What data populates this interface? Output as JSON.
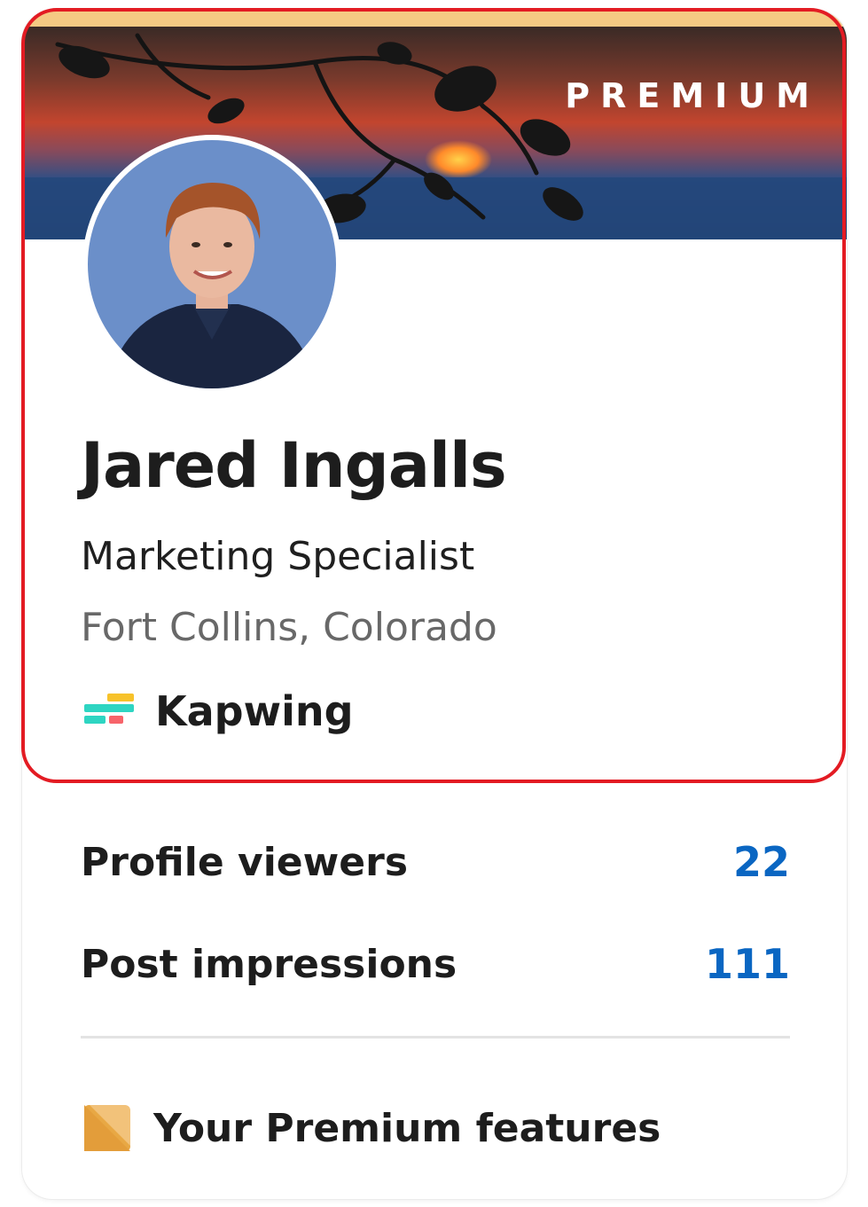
{
  "profile": {
    "badge": "PREMIUM",
    "name": "Jared Ingalls",
    "headline": "Marketing Specialist",
    "location": "Fort Collins, Colorado",
    "company": "Kapwing",
    "company_logo_icon": "kapwing-logo-icon"
  },
  "stats": [
    {
      "label": "Profile viewers",
      "value": "22"
    },
    {
      "label": "Post impressions",
      "value": "111"
    }
  ],
  "premium_features": {
    "label": "Your Premium features",
    "icon": "premium-square-icon"
  },
  "colors": {
    "accent_blue": "#0a66c2",
    "premium_gold": "#e8a844",
    "highlight_red": "#e31b23"
  }
}
